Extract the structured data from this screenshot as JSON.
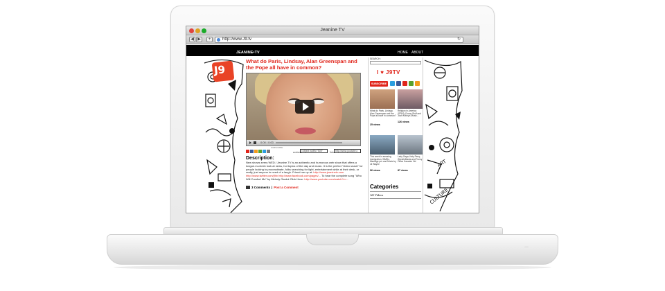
{
  "browser": {
    "window_title": "Jeanine TV",
    "url": "http://www.J9.tv",
    "reload_glyph": "↻",
    "back_glyph": "◀",
    "forward_glyph": "▶",
    "add_glyph": "+"
  },
  "site": {
    "brand": "JEANINE•TV",
    "logo_text": "J9",
    "nav": [
      "HOME",
      "ABOUT"
    ]
  },
  "post": {
    "date": "",
    "title": "What do Paris, Lindsay, Alan Greenspan and the Pope all have in common?",
    "video_time": "0:00 / 0:00",
    "subscribe_label": "SUBSCRIBE",
    "embed_label": "embed:",
    "embed_value": "<object width=\"500\"",
    "link_label": "link:",
    "link_value": "http://www.youtube.c",
    "description_heading": "Description:",
    "description_text": "New shows every WED.! Jeanine.TV is an authentic and humorous web show that offers a tongue-in-cheek look at news, hot topics of the day and music. It is the perfect \"video snack\" for people looking to procrastinate, folks searching for light, entertainment while at their desk, or really, just anyone in need of a laugh. Friend me up at:",
    "description_links": "http://www.jeaninetv.com http://www.twitter.com/j9tv http://www.facebook.com/pages/...",
    "description_more": "To hear the complete song \"Who Will Comfort Me\" by Melody Gardot Click Here:",
    "description_link2": "http://www.youtube.com/watch?v=...",
    "comments": "3 Comments",
    "post_comment": "Post a Comment"
  },
  "sidebar": {
    "search_label": "SEARCH:",
    "love_text": "I ♥ J9TV",
    "subscribe_label": "SUBSCRIBE",
    "videos": [
      {
        "caption": "What do Paris, Lindsay, Alan Greenspan and the Pope all have in common?",
        "views": "25 views"
      },
      {
        "caption": "Religion in America (SPIN), Funny Stuff and Josh Kelley's Music...",
        "views": "126 views"
      },
      {
        "caption": "This week in amazing immigration, WMDs, Marriage pro and Music by Lil Wayne",
        "views": "96 views"
      },
      {
        "caption": "Lady Gaga, Katy Perry, WrestleMania and Funny Office Karaoke Vid",
        "views": "87 views"
      }
    ],
    "categories_heading": "Categories",
    "categories": [
      "All Videos"
    ]
  },
  "colors": {
    "accent_red": "#e0251b",
    "logo_red": "#e94326",
    "header_black": "#000000"
  }
}
